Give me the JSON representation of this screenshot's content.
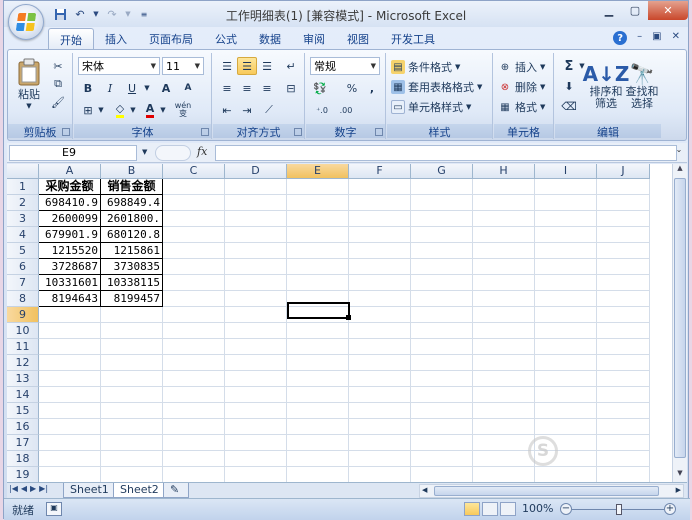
{
  "title_bar": {
    "title": "工作明细表(1)  [兼容模式] - Microsoft Excel"
  },
  "tabs": [
    "开始",
    "插入",
    "页面布局",
    "公式",
    "数据",
    "审阅",
    "视图",
    "开发工具"
  ],
  "ribbon": {
    "clipboard": {
      "label": "剪贴板",
      "paste": "粘贴"
    },
    "font": {
      "label": "字体",
      "font_name": "宋体",
      "font_size": "11",
      "bold": "B",
      "italic": "I",
      "underline": "U",
      "grow": "A",
      "shrink": "A",
      "wen": "wén",
      "wen2": "变"
    },
    "alignment": {
      "label": "对齐方式"
    },
    "number": {
      "label": "数字",
      "format": "常规",
      "percent": "%",
      "comma": ","
    },
    "styles": {
      "label": "样式",
      "conditional": "条件格式",
      "table_format": "套用表格格式",
      "cell_style": "单元格样式"
    },
    "cells": {
      "label": "单元格",
      "insert": "插入",
      "delete": "删除",
      "format": "格式"
    },
    "editing": {
      "label": "编辑",
      "sum": "Σ",
      "sort_filter_1": "排序和",
      "sort_filter_2": "筛选",
      "find_select_1": "查找和",
      "find_select_2": "选择"
    }
  },
  "formula_bar": {
    "name_box": "E9",
    "fx": "fx",
    "formula": ""
  },
  "grid": {
    "columns": [
      "A",
      "B",
      "C",
      "D",
      "E",
      "F",
      "G",
      "H",
      "I",
      "J"
    ],
    "rows": [
      "1",
      "2",
      "3",
      "4",
      "5",
      "6",
      "7",
      "8",
      "9",
      "10",
      "11",
      "12",
      "13",
      "14",
      "15",
      "16",
      "17",
      "18",
      "19"
    ],
    "header": [
      "采购金额",
      "销售金额"
    ],
    "data": [
      [
        "698410.9",
        "698849.4"
      ],
      [
        "2600099",
        "2601800."
      ],
      [
        "679901.9",
        "680120.8"
      ],
      [
        "1215520",
        "1215861"
      ],
      [
        "3728687",
        "3730835"
      ],
      [
        "10331601",
        "10338115"
      ],
      [
        "8194643",
        "8199457"
      ]
    ],
    "selected_cell": "E9"
  },
  "sheets": [
    "Sheet1",
    "Sheet2"
  ],
  "active_sheet": "Sheet2",
  "status": {
    "ready": "就绪",
    "zoom": "100%"
  },
  "watermark": {
    "text": "S"
  },
  "colors": {
    "accent": "#15428b",
    "selection": "#f1c15f",
    "close": "#c9472b"
  }
}
